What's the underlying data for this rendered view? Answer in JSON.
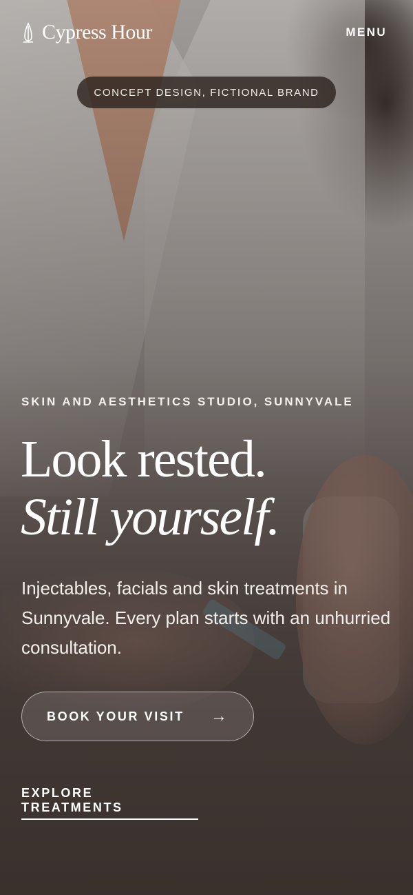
{
  "header": {
    "brand_name": "Cypress Hour",
    "menu_label": "MENU",
    "notice": "CONCEPT DESIGN, FICTIONAL BRAND"
  },
  "hero": {
    "eyebrow": "SKIN AND AESTHETICS STUDIO, SUNNYVALE",
    "headline_line1": "Look rested.",
    "headline_line2": "Still yourself.",
    "description": "Injectables, facials and skin treatments in Sunnyvale. Every plan starts with an unhurried consultation.",
    "primary_cta": "BOOK YOUR VISIT",
    "primary_cta_icon": "arrow-right-icon",
    "secondary_cta": "EXPLORE TREATMENTS"
  },
  "icons": {
    "brand": "cypress-tree-icon"
  },
  "colors": {
    "text": "#ffffff",
    "pill_bg": "#2d2420"
  }
}
